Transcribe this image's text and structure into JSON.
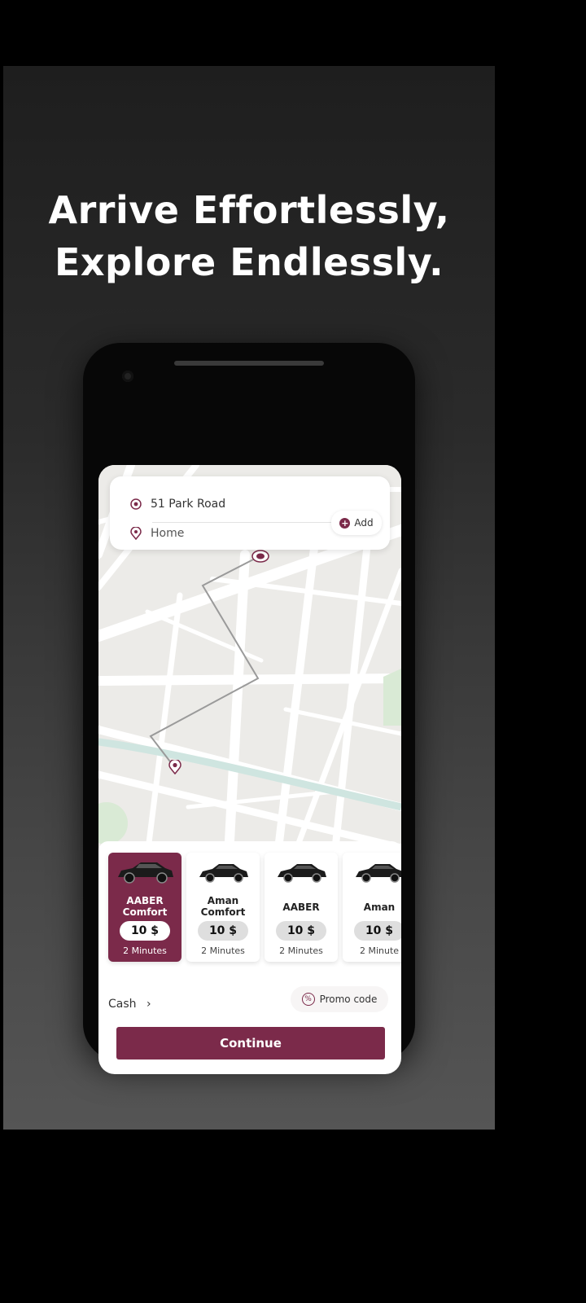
{
  "promo": {
    "headline_line1": "Arrive Effortlessly,",
    "headline_line2": "Explore Endlessly."
  },
  "app": {
    "accent_color": "#7b2a4a",
    "route": {
      "pickup": "51 Park Road",
      "destination": "Home",
      "add_label": "Add"
    },
    "rides": [
      {
        "name": "AABER Comfort",
        "price": "10 $",
        "eta": "2 Minutes",
        "selected": true
      },
      {
        "name": "Aman Comfort",
        "price": "10 $",
        "eta": "2 Minutes",
        "selected": false
      },
      {
        "name": "AABER",
        "price": "10 $",
        "eta": "2 Minutes",
        "selected": false
      },
      {
        "name": "Aman",
        "price": "10 $",
        "eta": "2 Minute",
        "selected": false
      }
    ],
    "payment": {
      "method": "Cash",
      "chevron": "›",
      "promo_label": "Promo code"
    },
    "continue_label": "Continue"
  }
}
